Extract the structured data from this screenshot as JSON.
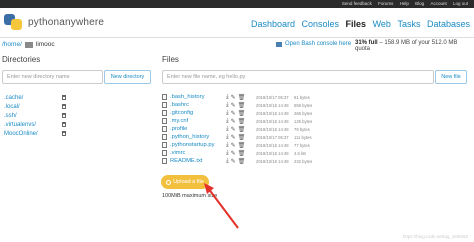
{
  "toplinks": [
    "Send feedback",
    "Forums",
    "Help",
    "Blog",
    "Account",
    "Log out"
  ],
  "brand": "pythonanywhere",
  "nav": [
    {
      "label": "Dashboard",
      "active": false
    },
    {
      "label": "Consoles",
      "active": false
    },
    {
      "label": "Files",
      "active": true
    },
    {
      "label": "Web",
      "active": false
    },
    {
      "label": "Tasks",
      "active": false
    },
    {
      "label": "Databases",
      "active": false
    }
  ],
  "breadcrumb": {
    "root": "/home/",
    "current": "limooc"
  },
  "bash_link": "Open Bash console here",
  "usage": {
    "percent": "31% full",
    "detail": " – 158.9 MB of your 512.0 MB quota"
  },
  "directories": {
    "heading": "Directories",
    "placeholder": "Enter new directory name",
    "button": "New directory",
    "items": [
      ".cache/",
      ".local/",
      ".ssh/",
      ".virtualenvs/",
      "MoocOnline/"
    ]
  },
  "files": {
    "heading": "Files",
    "placeholder": "Enter new file name, eg hello.py",
    "button": "New file",
    "items": [
      {
        "name": ".bash_history",
        "date": "2018/10/17 05:37",
        "size": "61 bytes"
      },
      {
        "name": ".bashrc",
        "date": "2018/10/16 14:48",
        "size": "559 bytes"
      },
      {
        "name": ".gitconfig",
        "date": "2018/10/16 14:48",
        "size": "266 bytes"
      },
      {
        "name": ".my.cnf",
        "date": "2018/10/16 14:48",
        "size": "125 bytes"
      },
      {
        "name": ".profile",
        "date": "2018/10/16 14:48",
        "size": "79 bytes"
      },
      {
        "name": ".python_history",
        "date": "2018/10/17 05:37",
        "size": "111 bytes"
      },
      {
        "name": ".pythonstartup.py",
        "date": "2018/10/16 14:48",
        "size": "77 bytes"
      },
      {
        "name": ".vimrc",
        "date": "2018/10/16 14:48",
        "size": "4.6 kB"
      },
      {
        "name": "README.txt",
        "date": "2018/10/16 14:48",
        "size": "232 bytes"
      }
    ]
  },
  "upload": {
    "label": "Upload a file",
    "note": "100MiB maximum size"
  },
  "watermark": "https://blog.csdn.net/qq_1509/62"
}
